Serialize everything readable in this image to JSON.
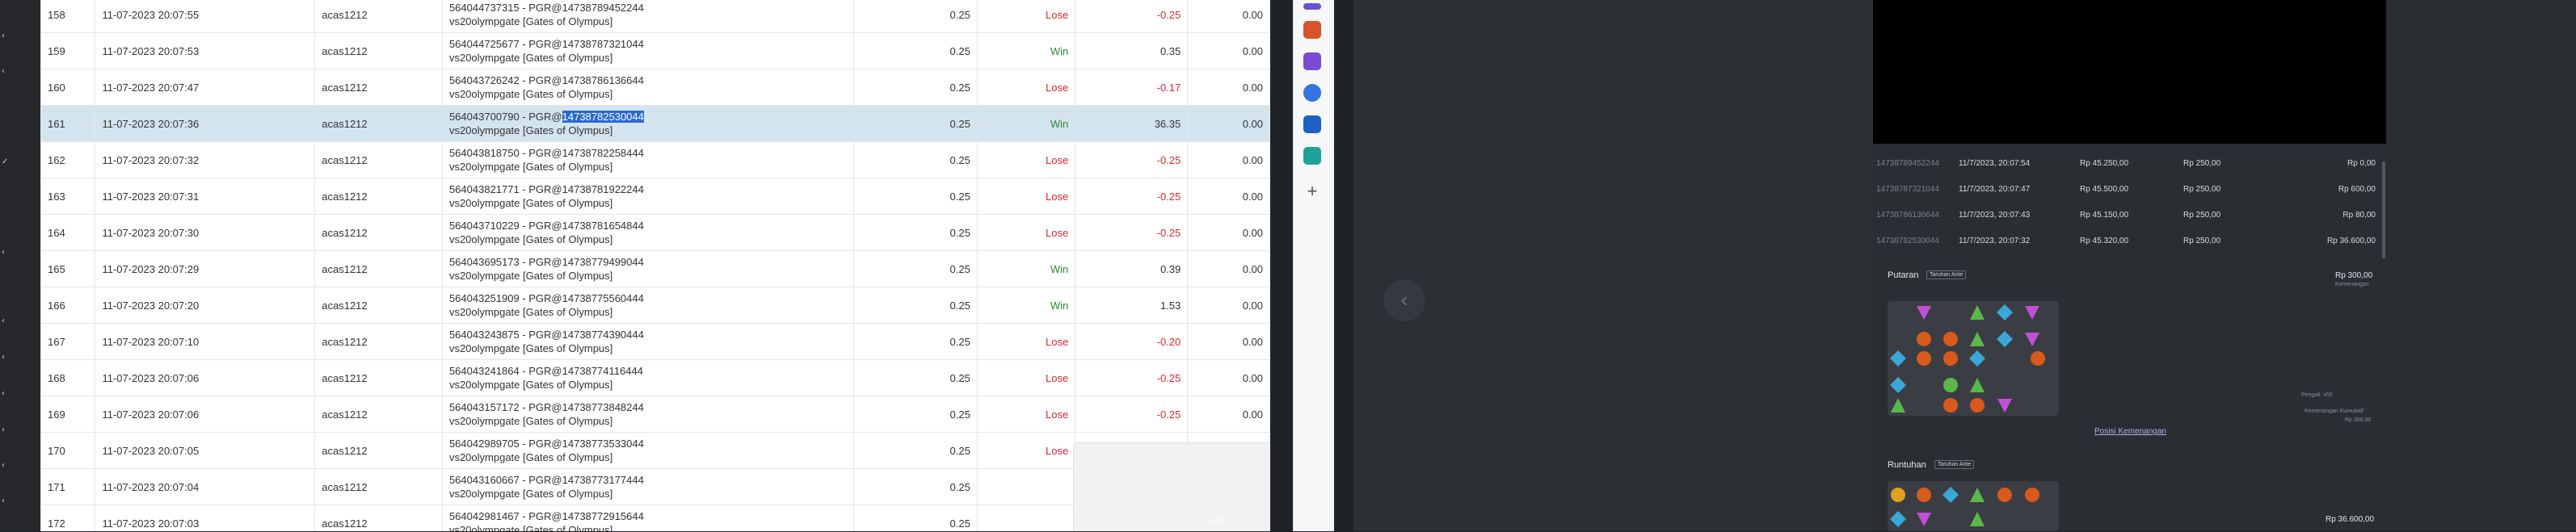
{
  "table": {
    "rows": [
      {
        "no": "158",
        "date": "11-07-2023 20:07:55",
        "user": "acas1212",
        "desc1": "564044737315 - PGR@14738789452244",
        "desc2": "vs20olympgate [Gates of Olympus]",
        "bet": "0.25",
        "result": "Lose",
        "win": "-0.25",
        "balance": "0.00"
      },
      {
        "no": "159",
        "date": "11-07-2023 20:07:53",
        "user": "acas1212",
        "desc1": "564044725677 - PGR@14738787321044",
        "desc2": "vs20olympgate [Gates of Olympus]",
        "bet": "0.25",
        "result": "Win",
        "win": "0.35",
        "balance": "0.00"
      },
      {
        "no": "160",
        "date": "11-07-2023 20:07:47",
        "user": "acas1212",
        "desc1": "564043726242 - PGR@14738786136644",
        "desc2": "vs20olympgate [Gates of Olympus]",
        "bet": "0.25",
        "result": "Lose",
        "win": "-0.17",
        "balance": "0.00"
      },
      {
        "no": "161",
        "date": "11-07-2023 20:07:36",
        "user": "acas1212",
        "desc1": "564043700790 - PGR@",
        "desc1_hl": "14738782530044",
        "desc2": "vs20olympgate [Gates of Olympus]",
        "bet": "0.25",
        "result": "Win",
        "win": "36.35",
        "balance": "0.00"
      },
      {
        "no": "162",
        "date": "11-07-2023 20:07:32",
        "user": "acas1212",
        "desc1": "564043818750 - PGR@14738782258444",
        "desc2": "vs20olympgate [Gates of Olympus]",
        "bet": "0.25",
        "result": "Lose",
        "win": "-0.25",
        "balance": "0.00"
      },
      {
        "no": "163",
        "date": "11-07-2023 20:07:31",
        "user": "acas1212",
        "desc1": "564043821771 - PGR@14738781922244",
        "desc2": "vs20olympgate [Gates of Olympus]",
        "bet": "0.25",
        "result": "Lose",
        "win": "-0.25",
        "balance": "0.00"
      },
      {
        "no": "164",
        "date": "11-07-2023 20:07:30",
        "user": "acas1212",
        "desc1": "564043710229 - PGR@14738781654844",
        "desc2": "vs20olympgate [Gates of Olympus]",
        "bet": "0.25",
        "result": "Lose",
        "win": "-0.25",
        "balance": "0.00"
      },
      {
        "no": "165",
        "date": "11-07-2023 20:07:29",
        "user": "acas1212",
        "desc1": "564043695173 - PGR@14738779499044",
        "desc2": "vs20olympgate [Gates of Olympus]",
        "bet": "0.25",
        "result": "Win",
        "win": "0.39",
        "balance": "0.00"
      },
      {
        "no": "166",
        "date": "11-07-2023 20:07:20",
        "user": "acas1212",
        "desc1": "564043251909 - PGR@14738775560444",
        "desc2": "vs20olympgate [Gates of Olympus]",
        "bet": "0.25",
        "result": "Win",
        "win": "1.53",
        "balance": "0.00"
      },
      {
        "no": "167",
        "date": "11-07-2023 20:07:10",
        "user": "acas1212",
        "desc1": "564043243875 - PGR@14738774390444",
        "desc2": "vs20olympgate [Gates of Olympus]",
        "bet": "0.25",
        "result": "Lose",
        "win": "-0.20",
        "balance": "0.00"
      },
      {
        "no": "168",
        "date": "11-07-2023 20:07:06",
        "user": "acas1212",
        "desc1": "564043241864 - PGR@14738774116444",
        "desc2": "vs20olympgate [Gates of Olympus]",
        "bet": "0.25",
        "result": "Lose",
        "win": "-0.25",
        "balance": "0.00"
      },
      {
        "no": "169",
        "date": "11-07-2023 20:07:06",
        "user": "acas1212",
        "desc1": "564043157172 - PGR@14738773848244",
        "desc2": "vs20olympgate [Gates of Olympus]",
        "bet": "0.25",
        "result": "Lose",
        "win": "-0.25",
        "balance": "0.00"
      },
      {
        "no": "170",
        "date": "11-07-2023 20:07:05",
        "user": "acas1212",
        "desc1": "564042989705 - PGR@14738773533044",
        "desc2": "vs20olympgate [Gates of Olympus]",
        "bet": "0.25",
        "result": "Lose",
        "win": "-0.25",
        "balance": "0.00"
      },
      {
        "no": "171",
        "date": "11-07-2023 20:07:04",
        "user": "acas1212",
        "desc1": "564043160667 - PGR@14738773177444",
        "desc2": "vs20olympgate [Gates of Olympus]",
        "bet": "0.25",
        "result": "",
        "win": "",
        "balance": "0.00"
      },
      {
        "no": "172",
        "date": "11-07-2023 20:07:03",
        "user": "acas1212",
        "desc1": "564042981467 - PGR@14738772915644",
        "desc2": "vs20olympgate [Gates of Olympus]",
        "bet": "0.25",
        "result": "",
        "win": "",
        "balance": "0.00"
      }
    ]
  },
  "popup": {
    "text": "Lose"
  },
  "back_button": {
    "label": "‹"
  },
  "history": {
    "rows": [
      {
        "id": "14738789452244",
        "time": "11/7/2023, 20:07:54",
        "bal": "Rp 45.250,00",
        "bet": "Rp 250,00",
        "win": "Rp 0,00"
      },
      {
        "id": "14738787321044",
        "time": "11/7/2023, 20:07:47",
        "bal": "Rp 45.500,00",
        "bet": "Rp 250,00",
        "win": "Rp 600,00"
      },
      {
        "id": "14738786136644",
        "time": "11/7/2023, 20:07:43",
        "bal": "Rp 45.150,00",
        "bet": "Rp 250,00",
        "win": "Rp 80,00"
      },
      {
        "id": "14738782530044",
        "time": "11/7/2023, 20:07:32",
        "bal": "Rp 45.320,00",
        "bet": "Rp 250,00",
        "win": "Rp 36.600,00"
      }
    ],
    "putaran": {
      "title": "Putaran",
      "tag": "Taruhan Ante",
      "amount": "Rp 300,00",
      "note1": "Kemenangan",
      "note2": "Pengali: x50",
      "note3": "Kemenangan Kumulatif",
      "note4": "Rp 300,00",
      "link": "Posisi Kemenangan"
    },
    "runtuhan": {
      "title": "Runtuhan",
      "tag": "Taruhan Ante",
      "amount": "Rp 36.600,00"
    }
  },
  "colors": {
    "win": "#2c8a2c",
    "lose": "#e0262c",
    "selected_row": "#d3e4ee",
    "highlight": "#2a6bd1"
  }
}
